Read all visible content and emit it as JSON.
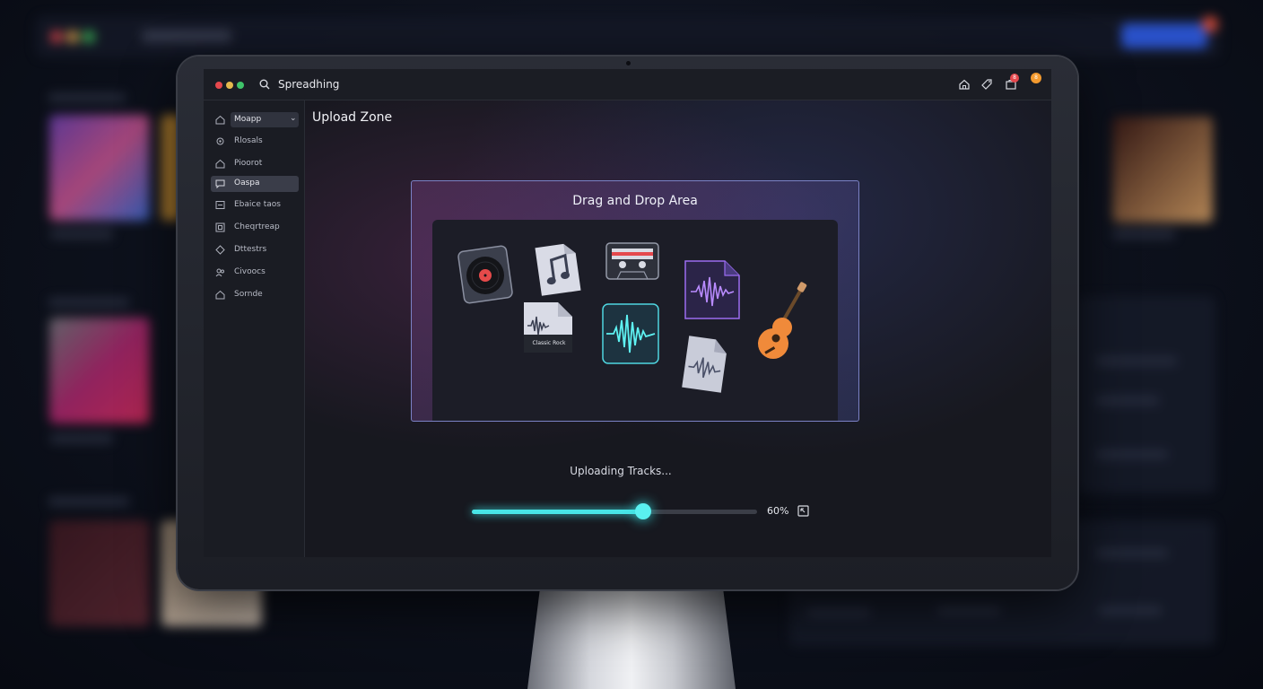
{
  "app": {
    "title": "Spreadhing",
    "notification_count": "8",
    "avatar_initial": "8"
  },
  "sidebar": {
    "items": [
      {
        "label": "Moapp",
        "icon": "home-icon",
        "selected": false,
        "dropdown": true
      },
      {
        "label": "Rlosals",
        "icon": "gear-icon"
      },
      {
        "label": "Pioorot",
        "icon": "home-icon"
      },
      {
        "label": "Oaspa",
        "icon": "chat-icon",
        "active": true
      },
      {
        "label": "Ebaice taos",
        "icon": "list-icon"
      },
      {
        "label": "Cheqrtreap",
        "icon": "square-icon"
      },
      {
        "label": "Dttestrs",
        "icon": "diamond-icon"
      },
      {
        "label": "Civoocs",
        "icon": "people-icon"
      },
      {
        "label": "Sornde",
        "icon": "home-icon"
      }
    ]
  },
  "main": {
    "title": "Upload Zone",
    "dropzone_title": "Drag and Drop Area",
    "file_label": "Classic Rock",
    "status": "Uploading Tracks...",
    "progress": 0.6,
    "progress_label": "60%"
  },
  "colors": {
    "accent": "#48e5e6",
    "dropzone_border": "#7b82c6",
    "badge": "#e5484d",
    "avatar": "#f39a2f"
  }
}
